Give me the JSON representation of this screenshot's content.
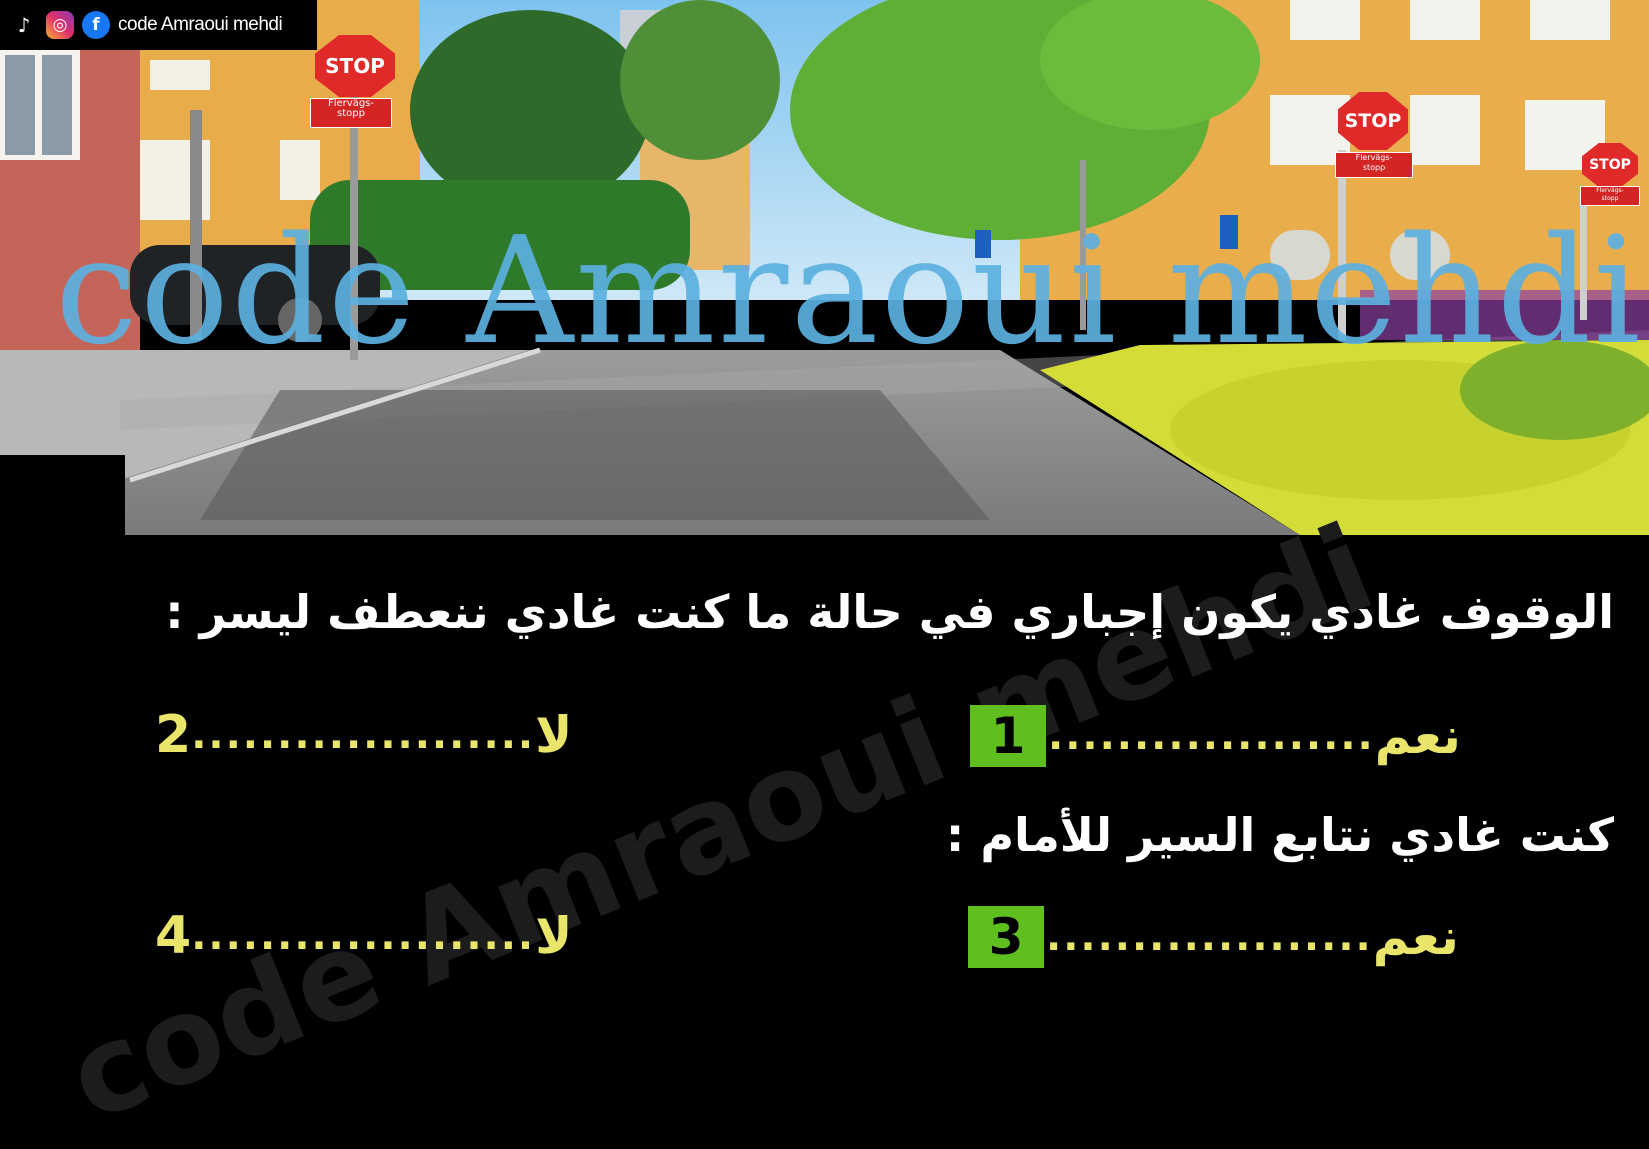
{
  "channel": {
    "name": "code Amraoui mehdi",
    "icons": [
      "tiktok-icon",
      "instagram-icon",
      "facebook-icon"
    ]
  },
  "watermark": "code Amraoui mehdi",
  "signs": {
    "stop_text": "STOP",
    "plate_line1": "Flervägs-",
    "plate_line2": "stopp"
  },
  "questions": [
    {
      "text": "الوقوف غادي يكون إجباري في حالة ما كنت غادي ننعطف ليسر :",
      "options": [
        {
          "number": "1",
          "label": "نعم",
          "dots": "...................",
          "selected": true
        },
        {
          "number": "2",
          "label": "لا",
          "dots": "....................",
          "selected": false
        }
      ]
    },
    {
      "text": "كنت غادي نتابع السير للأمام :",
      "options": [
        {
          "number": "3",
          "label": "نعم",
          "dots": "...................",
          "selected": true
        },
        {
          "number": "4",
          "label": "لا",
          "dots": "....................",
          "selected": false
        }
      ]
    }
  ],
  "colors": {
    "badge": "#5fbf1f",
    "answer_text": "#e9e56a",
    "question_text": "#ffffff",
    "background": "#000000",
    "watermark_top": "#5cb0e0"
  }
}
